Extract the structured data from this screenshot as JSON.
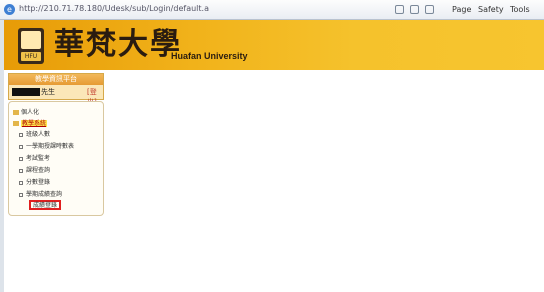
{
  "browser": {
    "url": "http://210.71.78.180/Udesk/sub/Login/default.aspx",
    "commands": [
      {
        "label": "Page",
        "icon": "page-icon"
      },
      {
        "label": "Safety",
        "icon": "safety-icon"
      },
      {
        "label": "Tools",
        "icon": "tools-icon"
      }
    ]
  },
  "banner": {
    "logo_text": "HFU",
    "name_cn": "華梵大學",
    "name_en": "Huafan University"
  },
  "login": {
    "title": "教學資訊平台",
    "user_name": "先生",
    "logout_label": "[登出]"
  },
  "menu": {
    "items": [
      {
        "label": "個人化",
        "kind": "folder"
      },
      {
        "label": "教學系統",
        "kind": "folder",
        "active": true
      },
      {
        "label": "班級人數",
        "kind": "bullet"
      },
      {
        "label": "一學期授課時數表",
        "kind": "bullet"
      },
      {
        "label": "考試監考",
        "kind": "bullet"
      },
      {
        "label": "課程查詢",
        "kind": "bullet"
      },
      {
        "label": "分數登錄",
        "kind": "bullet"
      },
      {
        "label": "學期成績查詢",
        "kind": "bullet"
      },
      {
        "label": "成績登錄",
        "kind": "bullet",
        "highlighted": true
      }
    ]
  }
}
